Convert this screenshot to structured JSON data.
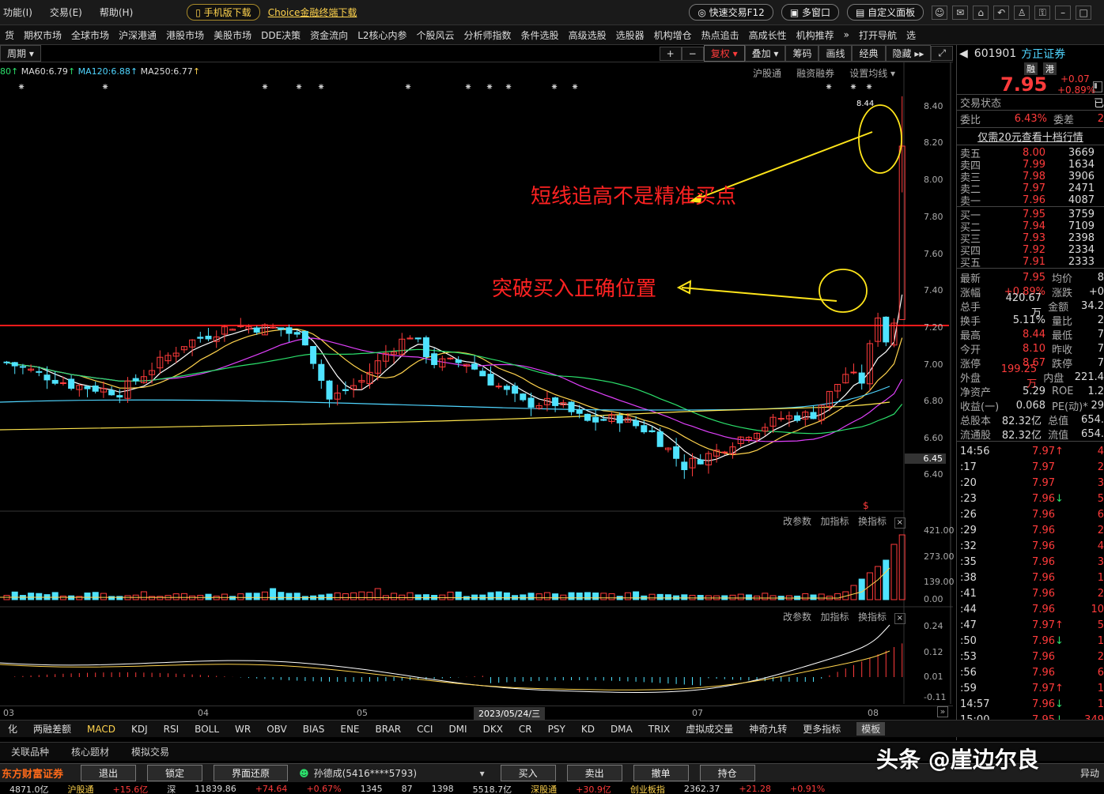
{
  "menu": {
    "items": [
      "功能(I)",
      "交易(E)",
      "帮助(H)"
    ],
    "mobile_btn": "手机版下载",
    "choice_link": "Choice金融终端下载",
    "fast_trade": "快速交易F12",
    "multi_window": "多窗口",
    "custom_board": "自定义面板"
  },
  "nav": {
    "items": [
      "货",
      "期权市场",
      "全球市场",
      "沪深港通",
      "港股市场",
      "美股市场",
      "DDE决策",
      "资金流向",
      "L2核心内参",
      "个股风云",
      "分析师指数",
      "条件选股",
      "高级选股",
      "选股器",
      "机构增仓",
      "热点追击",
      "高成长性",
      "机构推荐",
      "»",
      "打开导航",
      "选"
    ]
  },
  "toolbar": {
    "period": "周期",
    "fuquan": "复权",
    "overlay": "叠加",
    "chouma": "筹码",
    "huaxian": "画线",
    "jingdian": "经典",
    "yincang": "隐藏"
  },
  "ma": {
    "prefix": "80",
    "ma60": "MA60:6.79",
    "ma120": "MA120:6.88",
    "ma250": "MA250:6.77",
    "links": [
      "沪股通",
      "融资融券",
      "设置均线"
    ]
  },
  "sub": {
    "gaicanshu": "改参数",
    "jiazhibiao": "加指标",
    "huanzhibiao": "换指标"
  },
  "annotations": {
    "top": "短线追高不是精准买点",
    "mid": "突破买入正确位置"
  },
  "price_axis": {
    "labels": [
      "8.40",
      "8.20",
      "8.00",
      "7.80",
      "7.60",
      "7.40",
      "7.20",
      "7.00",
      "6.80",
      "6.60",
      "6.45",
      "6.40"
    ],
    "high_label": "8.44"
  },
  "vol_axis": [
    "421.00",
    "273.00",
    "139.00",
    "0.00"
  ],
  "macd_axis": [
    "0.24",
    "0.12",
    "0.01",
    "-0.11"
  ],
  "date_axis": {
    "labels": [
      "03",
      "04",
      "05",
      "07",
      "08"
    ],
    "cursor": "2023/05/24/三"
  },
  "stock": {
    "code": "601901",
    "name": "方正证券",
    "tag1": "融",
    "tag2": "港",
    "price": "7.95",
    "change": "+0.07",
    "pct": "+0.89%",
    "state_label": "交易状态",
    "state": "已",
    "weibi_label": "委比",
    "weibi": "6.43%",
    "weicha_label": "委差",
    "weicha": "2",
    "promo": "仅需20元查看十档行情"
  },
  "asks": [
    {
      "l": "卖五",
      "p": "8.00",
      "v": "3669"
    },
    {
      "l": "卖四",
      "p": "7.99",
      "v": "1634"
    },
    {
      "l": "卖三",
      "p": "7.98",
      "v": "3906"
    },
    {
      "l": "卖二",
      "p": "7.97",
      "v": "2471"
    },
    {
      "l": "卖一",
      "p": "7.96",
      "v": "4087"
    }
  ],
  "bids": [
    {
      "l": "买一",
      "p": "7.95",
      "v": "3759"
    },
    {
      "l": "买二",
      "p": "7.94",
      "v": "7109"
    },
    {
      "l": "买三",
      "p": "7.93",
      "v": "2398"
    },
    {
      "l": "买四",
      "p": "7.92",
      "v": "2334"
    },
    {
      "l": "买五",
      "p": "7.91",
      "v": "2333"
    }
  ],
  "stats": [
    {
      "a": "最新",
      "av": "7.95",
      "ac": "r",
      "b": "均价",
      "bv": "8"
    },
    {
      "a": "涨幅",
      "av": "+0.89%",
      "ac": "r",
      "b": "涨跌",
      "bv": "+0"
    },
    {
      "a": "总手",
      "av": "420.67万",
      "ac": "w",
      "b": "金额",
      "bv": "34.2"
    },
    {
      "a": "换手",
      "av": "5.11%",
      "ac": "w",
      "b": "量比",
      "bv": "2"
    },
    {
      "a": "最高",
      "av": "8.44",
      "ac": "r",
      "b": "最低",
      "bv": "7"
    },
    {
      "a": "今开",
      "av": "8.10",
      "ac": "r",
      "b": "昨收",
      "bv": "7"
    },
    {
      "a": "涨停",
      "av": "8.67",
      "ac": "r",
      "b": "跌停",
      "bv": "7"
    },
    {
      "a": "外盘",
      "av": "199.25万",
      "ac": "r",
      "b": "内盘",
      "bv": "221.4"
    },
    {
      "a": "净资产",
      "av": "5.29",
      "ac": "w",
      "b": "ROE",
      "bv": "1.2"
    },
    {
      "a": "收益(一)",
      "av": "0.068",
      "ac": "w",
      "b": "PE(动)*",
      "bv": "29"
    },
    {
      "a": "总股本",
      "av": "82.32亿",
      "ac": "w",
      "b": "总值",
      "bv": "654."
    },
    {
      "a": "流通股",
      "av": "82.32亿",
      "ac": "w",
      "b": "流值",
      "bv": "654."
    }
  ],
  "ticks": [
    {
      "t": "14:56",
      "p": "7.97",
      "d": "↑",
      "v": "4"
    },
    {
      "t": ":17",
      "p": "7.97",
      "d": "",
      "v": "2"
    },
    {
      "t": ":20",
      "p": "7.97",
      "d": "",
      "v": "3"
    },
    {
      "t": ":23",
      "p": "7.96",
      "d": "↓",
      "v": "5"
    },
    {
      "t": ":26",
      "p": "7.96",
      "d": "",
      "v": "6"
    },
    {
      "t": ":29",
      "p": "7.96",
      "d": "",
      "v": "2"
    },
    {
      "t": ":32",
      "p": "7.96",
      "d": "",
      "v": "4"
    },
    {
      "t": ":35",
      "p": "7.96",
      "d": "",
      "v": "3"
    },
    {
      "t": ":38",
      "p": "7.96",
      "d": "",
      "v": "1"
    },
    {
      "t": ":41",
      "p": "7.96",
      "d": "",
      "v": "2"
    },
    {
      "t": ":44",
      "p": "7.96",
      "d": "",
      "v": "10"
    },
    {
      "t": ":47",
      "p": "7.97",
      "d": "↑",
      "v": "5"
    },
    {
      "t": ":50",
      "p": "7.96",
      "d": "↓",
      "v": "1"
    },
    {
      "t": ":53",
      "p": "7.96",
      "d": "",
      "v": "2"
    },
    {
      "t": ":56",
      "p": "7.96",
      "d": "",
      "v": "6"
    },
    {
      "t": ":59",
      "p": "7.97",
      "d": "↑",
      "v": "1"
    },
    {
      "t": "14:57",
      "p": "7.96",
      "d": "↓",
      "v": "1"
    },
    {
      "t": "15:00",
      "p": "7.95",
      "d": "↓",
      "v": "349"
    }
  ],
  "indicators": [
    "化",
    "两融差额",
    "MACD",
    "KDJ",
    "RSI",
    "BOLL",
    "WR",
    "OBV",
    "BIAS",
    "ENE",
    "BRAR",
    "CCI",
    "DMI",
    "DKX",
    "CR",
    "PSY",
    "KD",
    "DMA",
    "TRIX",
    "虚拟成交量",
    "神奇九转",
    "更多指标",
    "模板"
  ],
  "funcs": [
    "关联品种",
    "核心题材",
    "模拟交易"
  ],
  "trade": {
    "brand": "东方财富证券",
    "exit": "退出",
    "lock": "锁定",
    "restore": "界面还原",
    "user": "孙德成(5416****5793)",
    "buy": "买入",
    "sell": "卖出",
    "cancel": "撤单",
    "position": "持仓",
    "right": "异动"
  },
  "watermark": "头条 @崖边尔良",
  "status": [
    "4871.0亿",
    "沪股通",
    "+15.6亿",
    "深",
    "11839.86",
    "+74.64",
    "+0.67%",
    "1345",
    "87",
    "1398",
    "5518.7亿",
    "深股通",
    "+30.9亿",
    "创业板指",
    "2362.37",
    "+21.28",
    "+0.91%"
  ]
}
